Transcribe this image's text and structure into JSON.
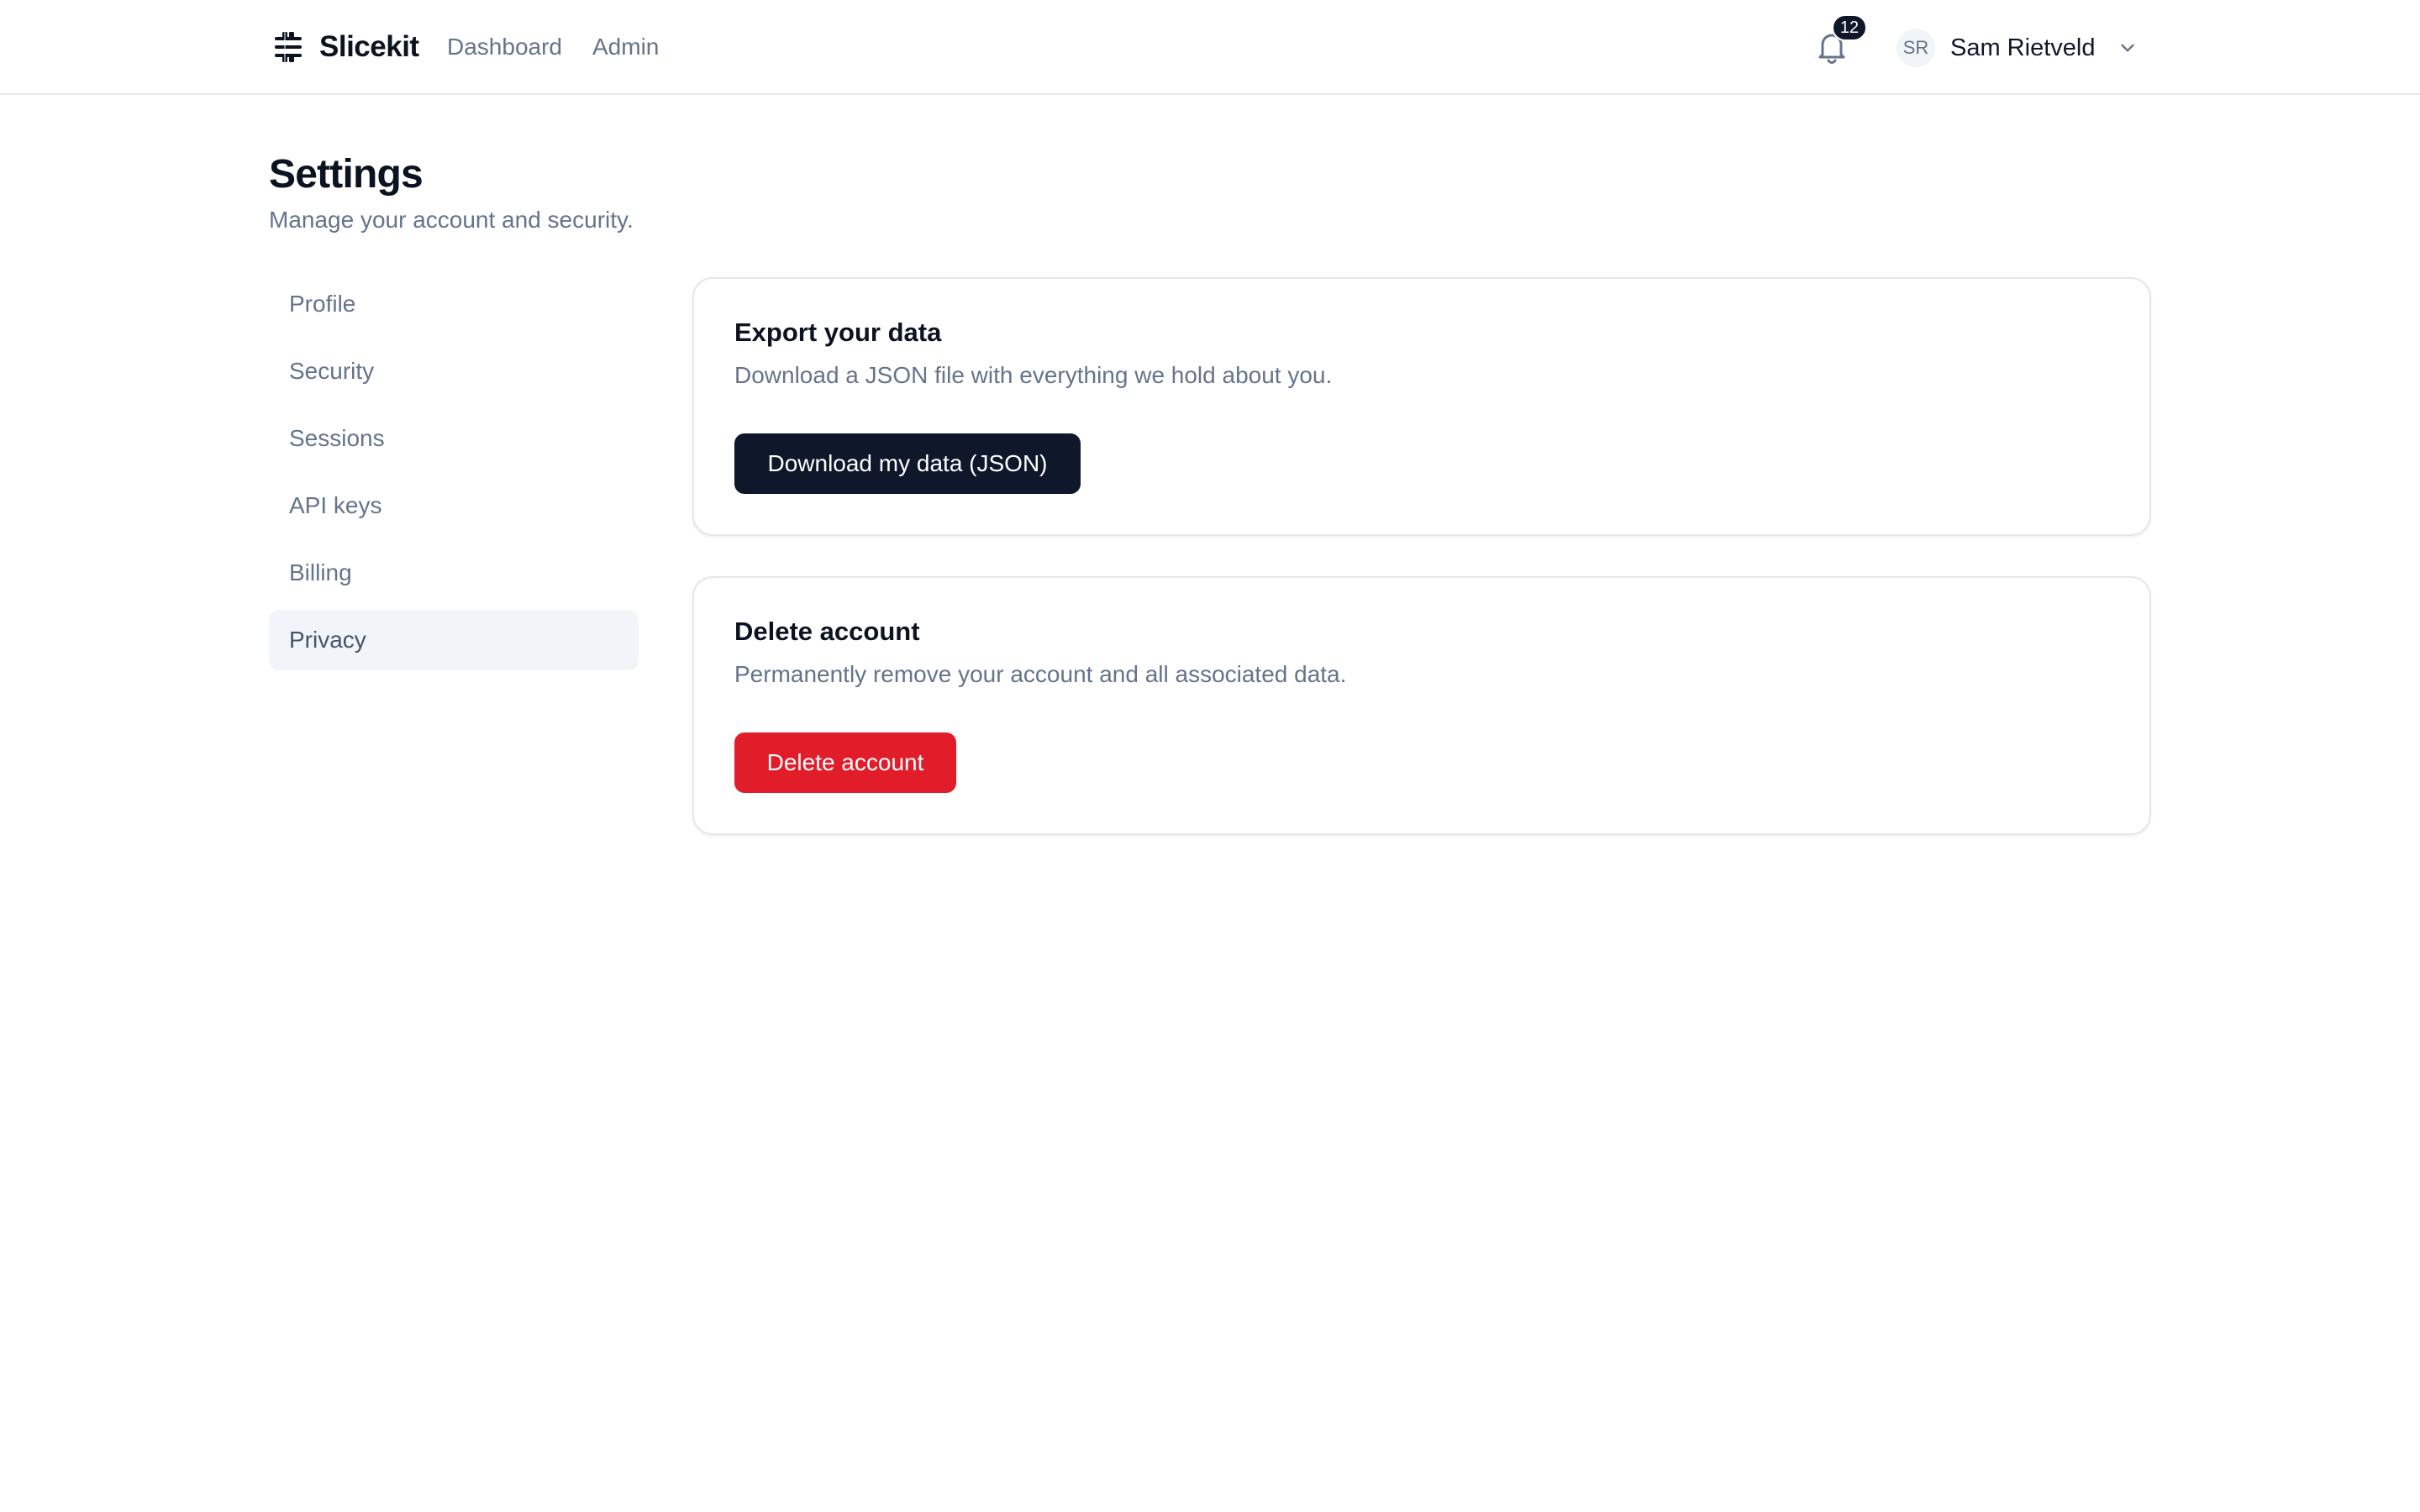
{
  "brand": {
    "name": "Slicekit",
    "icon": "slicekit-logo"
  },
  "nav": {
    "dashboard": "Dashboard",
    "admin": "Admin"
  },
  "notifications": {
    "icon": "bell-icon",
    "count": "12"
  },
  "user": {
    "initials": "SR",
    "name": "Sam Rietveld",
    "menu_icon": "chevron-down-icon"
  },
  "page": {
    "title": "Settings",
    "subtitle": "Manage your account and security."
  },
  "sidebar": {
    "items": [
      {
        "label": "Profile",
        "active": false
      },
      {
        "label": "Security",
        "active": false
      },
      {
        "label": "Sessions",
        "active": false
      },
      {
        "label": "API keys",
        "active": false
      },
      {
        "label": "Billing",
        "active": false
      },
      {
        "label": "Privacy",
        "active": true
      }
    ]
  },
  "export": {
    "title": "Export your data",
    "description": "Download a JSON file with everything we hold about you.",
    "button": "Download my data (JSON)"
  },
  "delete": {
    "title": "Delete account",
    "description": "Permanently remove your account and all associated data.",
    "button": "Delete account"
  },
  "colors": {
    "primary": "#0f172a",
    "danger": "#e11d2a",
    "muted_text": "#64748b",
    "active_bg": "#f1f5f9",
    "border": "#e5e7eb"
  }
}
